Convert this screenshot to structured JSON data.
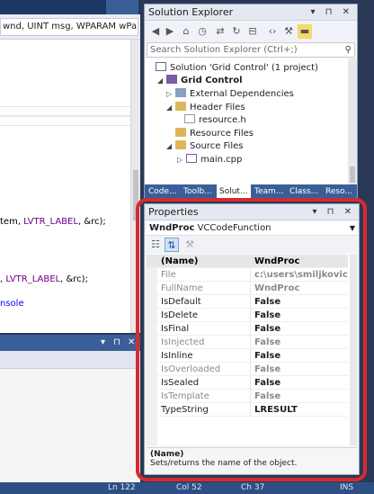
{
  "editor": {
    "function_dropdown": "wnd, UINT msg, WPARAM wPara",
    "code_lines": [
      {
        "pre": "tem, ",
        "mac": "LVTR_LABEL",
        "post": ", &rc);"
      },
      {
        "pre": ", ",
        "mac": "LVTR_LABEL",
        "post": ", &rc);"
      },
      {
        "pre": "",
        "mac": "",
        "post": "nsole"
      }
    ]
  },
  "solution_explorer": {
    "title": "Solution Explorer",
    "title_buttons": "▾ ⊓ ✕",
    "search_placeholder": "Search Solution Explorer (Ctrl+;)",
    "tree": [
      {
        "label": "Solution 'Grid Control' (1 project)",
        "icon": "solution-icon"
      },
      {
        "label": "Grid Control",
        "icon": "project-icon"
      },
      {
        "label": "External Dependencies",
        "icon": "external-deps-icon"
      },
      {
        "label": "Header Files",
        "icon": "folder-icon"
      },
      {
        "label": "resource.h",
        "icon": "header-file-icon"
      },
      {
        "label": "Resource Files",
        "icon": "folder-icon"
      },
      {
        "label": "Source Files",
        "icon": "folder-icon"
      },
      {
        "label": "main.cpp",
        "icon": "cpp-file-icon"
      }
    ],
    "tabs": [
      "Code...",
      "Toolb...",
      "Solut...",
      "Team...",
      "Class...",
      "Reso..."
    ]
  },
  "properties": {
    "title": "Properties",
    "title_buttons": "▾ ⊓ ✕",
    "object_name": "WndProc",
    "object_type": "VCCodeFunction",
    "rows": [
      {
        "name": "(Name)",
        "value": "WndProc"
      },
      {
        "name": "File",
        "value": "c:\\users\\smiljkovic\\docume"
      },
      {
        "name": "FullName",
        "value": "WndProc"
      },
      {
        "name": "IsDefault",
        "value": "False"
      },
      {
        "name": "IsDelete",
        "value": "False"
      },
      {
        "name": "IsFinal",
        "value": "False"
      },
      {
        "name": "IsInjected",
        "value": "False"
      },
      {
        "name": "IsInline",
        "value": "False"
      },
      {
        "name": "IsOverloaded",
        "value": "False"
      },
      {
        "name": "IsSealed",
        "value": "False"
      },
      {
        "name": "IsTemplate",
        "value": "False"
      },
      {
        "name": "TypeString",
        "value": "LRESULT"
      }
    ],
    "description_name": "(Name)",
    "description_text": "Sets/returns the name of the object."
  },
  "status": {
    "line": "Ln 122",
    "col": "Col 52",
    "ch": "Ch 37",
    "mode": "INS"
  },
  "colors": {
    "highlight_ring": "#d72a2f",
    "accent": "#3a5f98"
  }
}
